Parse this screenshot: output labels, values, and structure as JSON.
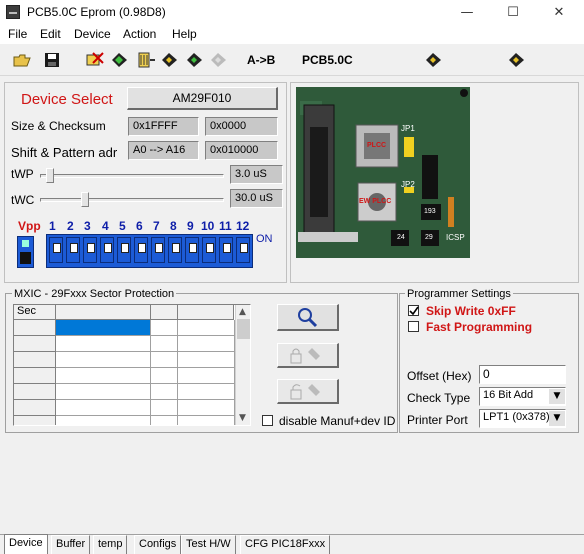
{
  "window": {
    "title": "PCB5.0C Eprom (0.98D8)",
    "min": "—",
    "max": "☐",
    "close": "✕"
  },
  "menu": [
    "File",
    "Edit",
    "Device",
    "Action",
    "Help"
  ],
  "toolbar": {
    "a_b": "A->B",
    "pcb": "PCB5.0C"
  },
  "device": {
    "select_label": "Device Select",
    "device_name": "AM29F010",
    "size_label": "Size & Checksum",
    "size_value": "0x1FFFF",
    "checksum_value": "0x0000",
    "shift_label": "Shift & Pattern adr",
    "shift_value": "A0 --> A16",
    "pattern_value": "0x010000",
    "twp_label": "tWP",
    "twp_value": "3.0 uS",
    "twp_level": 0.02,
    "twc_label": "tWC",
    "twc_value": "30.0 uS",
    "twc_level": 0.22
  },
  "vpp": {
    "label": "Vpp",
    "numbers": [
      "1",
      "2",
      "3",
      "4",
      "5",
      "6",
      "7",
      "8",
      "9",
      "10",
      "11",
      "12"
    ],
    "on_label": "ON"
  },
  "board_image": {
    "jp1": "JP1",
    "jp2": "JP2",
    "plcc": "PLCC",
    "ewplcc": "EW PLCC",
    "chip1": "24",
    "chip2": "29",
    "chip3": "193",
    "icsp": "ICSP"
  },
  "sector": {
    "group_title": "MXIC - 29Fxxx Sector Protection",
    "col_header": "Sec",
    "disable_label": "disable Manuf+dev ID"
  },
  "settings": {
    "group_title": "Programmer Settings",
    "skip_write": "Skip Write 0xFF",
    "fast_programming": "Fast Programming",
    "offset_label": "Offset (Hex)",
    "offset_value": "0",
    "check_type_label": "Check Type",
    "check_type_value": "16 Bit Add",
    "printer_port_label": "Printer Port",
    "printer_port_value": "LPT1 (0x378)"
  },
  "tabs": [
    "Device",
    "Buffer",
    "temp",
    "Configs",
    "Test H/W",
    "CFG PIC18Fxxx"
  ],
  "colors": {
    "accent_red": "#d01616",
    "vpp_blue": "#1c5bd6",
    "board_green": "#2f5a3a"
  }
}
